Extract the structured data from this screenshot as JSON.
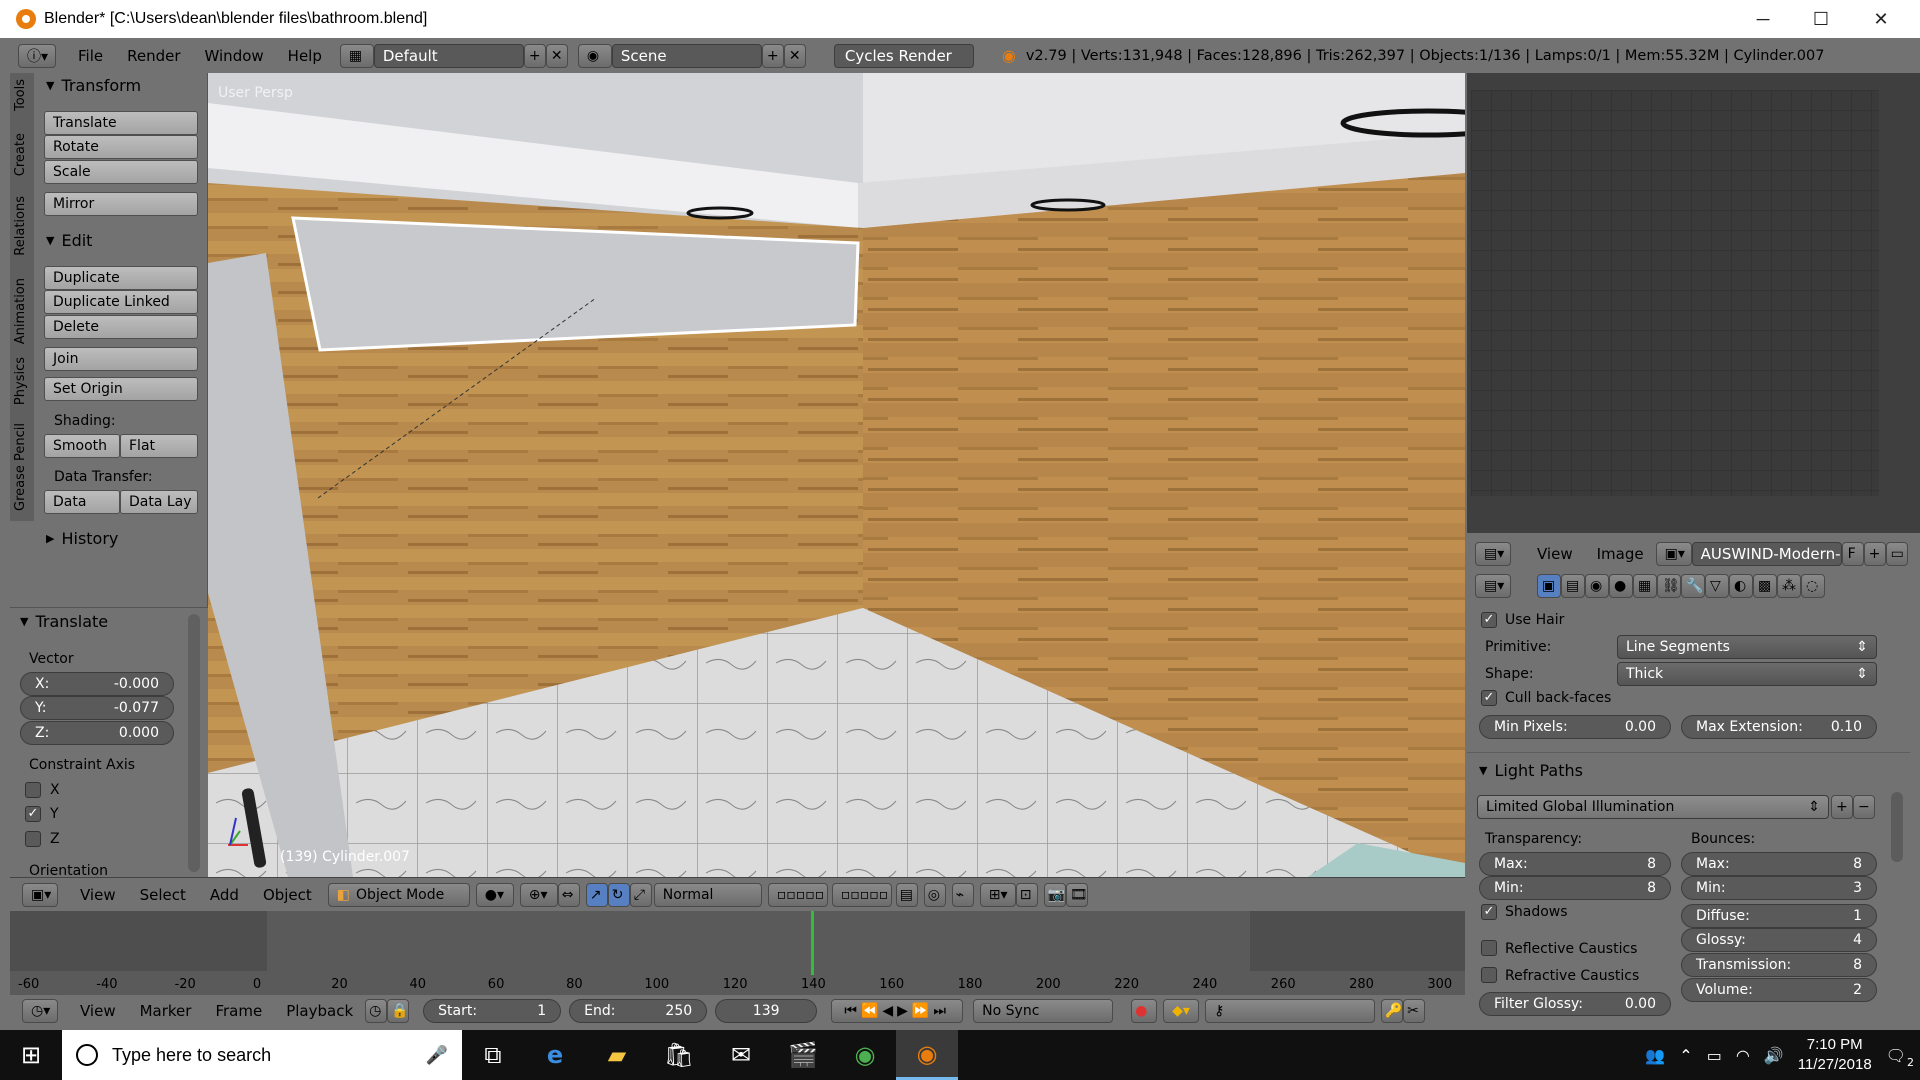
{
  "window": {
    "title": "Blender* [C:\\Users\\dean\\blender files\\bathroom.blend]",
    "minimize": "─",
    "maximize": "☐",
    "close": "✕"
  },
  "infobar": {
    "menus": [
      "File",
      "Render",
      "Window",
      "Help"
    ],
    "layout": "Default",
    "scene": "Scene",
    "engine": "Cycles Render",
    "stats": "v2.79 | Verts:131,948 | Faces:128,896 | Tris:262,397 | Objects:1/136 | Lamps:0/1 | Mem:55.32M | Cylinder.007"
  },
  "tabs": [
    "Tools",
    "Create",
    "Relations",
    "Animation",
    "Physics",
    "Grease Pencil"
  ],
  "toolshelf": {
    "transform_title": "Transform",
    "translate": "Translate",
    "rotate": "Rotate",
    "scale": "Scale",
    "mirror": "Mirror",
    "edit_title": "Edit",
    "duplicate": "Duplicate",
    "duplicate_linked": "Duplicate Linked",
    "delete": "Delete",
    "join": "Join",
    "set_origin": "Set Origin",
    "shading_label": "Shading:",
    "smooth": "Smooth",
    "flat": "Flat",
    "data_transfer_label": "Data Transfer:",
    "data": "Data",
    "data_lay": "Data Lay",
    "history_title": "History"
  },
  "operator": {
    "title": "Translate",
    "vector_label": "Vector",
    "x_label": "X:",
    "x": "-0.000",
    "y_label": "Y:",
    "y": "-0.077",
    "z_label": "Z:",
    "z": "0.000",
    "constraint_label": "Constraint Axis",
    "axis_x": "X",
    "axis_y": "Y",
    "axis_z": "Z",
    "orientation_label": "Orientation"
  },
  "viewport": {
    "view_name": "User Persp",
    "object_label": "(139) Cylinder.007"
  },
  "vphdr": {
    "menus": [
      "View",
      "Select",
      "Add",
      "Object"
    ],
    "mode": "Object Mode",
    "pivot": "Normal"
  },
  "timeline": {
    "ticks": [
      "-60",
      "-40",
      "-20",
      "0",
      "20",
      "40",
      "60",
      "80",
      "100",
      "120",
      "140",
      "160",
      "180",
      "200",
      "220",
      "240",
      "260",
      "280",
      "300"
    ],
    "current_frame": 140
  },
  "tlbar": {
    "menus": [
      "View",
      "Marker",
      "Frame",
      "Playback"
    ],
    "start_label": "Start:",
    "start": "1",
    "end_label": "End:",
    "end": "250",
    "frame": "139",
    "sync": "No Sync"
  },
  "imgeditor": {
    "menus": [
      "View",
      "Image"
    ],
    "image_name": "AUSWIND-Modern-...",
    "fake_user": "F"
  },
  "props": {
    "use_hair": "Use Hair",
    "primitive_label": "Primitive:",
    "primitive": "Line Segments",
    "shape_label": "Shape:",
    "shape": "Thick",
    "cull_backfaces": "Cull back-faces",
    "min_pixels_label": "Min Pixels:",
    "min_pixels": "0.00",
    "max_extension_label": "Max Extension:",
    "max_extension": "0.10",
    "light_paths_title": "Light Paths",
    "preset": "Limited Global Illumination",
    "transparency_label": "Transparency:",
    "bounces_label": "Bounces:",
    "t_max_label": "Max:",
    "t_max": "8",
    "t_min_label": "Min:",
    "t_min": "8",
    "b_max_label": "Max:",
    "b_max": "8",
    "b_min_label": "Min:",
    "b_min": "3",
    "shadows": "Shadows",
    "reflective_caustics": "Reflective Caustics",
    "refractive_caustics": "Refractive Caustics",
    "diffuse_label": "Diffuse:",
    "diffuse": "1",
    "glossy_label": "Glossy:",
    "glossy": "4",
    "transmission_label": "Transmission:",
    "transmission": "8",
    "volume_label": "Volume:",
    "volume": "2",
    "filter_glossy_label": "Filter Glossy:",
    "filter_glossy": "0.00"
  },
  "taskbar": {
    "search_placeholder": "Type here to search",
    "time": "7:10 PM",
    "date": "11/27/2018",
    "notifications": "2"
  },
  "colors": {
    "wood": "#b8864a",
    "floor": "#d4d4d4",
    "ceiling": "#e8e8ea",
    "blender_orange": "#e87d0d"
  }
}
